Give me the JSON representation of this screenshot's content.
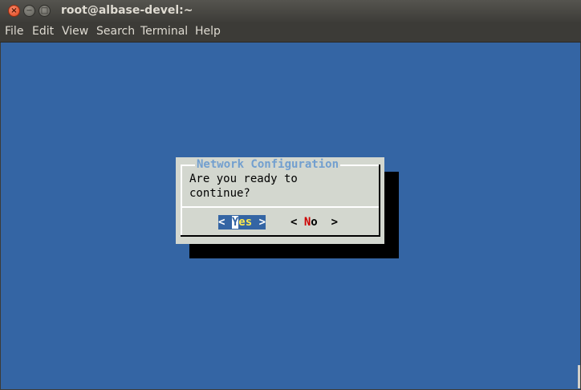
{
  "window": {
    "title": "root@albase-devel:~",
    "close_glyph": "×",
    "minimize_glyph": "−",
    "maximize_glyph": "□"
  },
  "menubar": {
    "items": [
      "File",
      "Edit",
      "View",
      "Search",
      "Terminal",
      "Help"
    ]
  },
  "dialog": {
    "title": "Network Configuration",
    "message_line1": "Are you ready to",
    "message_line2": "continue?",
    "yes_button": {
      "open": "< ",
      "hotkey": "Y",
      "rest": "es",
      "close": " >"
    },
    "no_button": {
      "open": "< ",
      "hotkey": "N",
      "rest": "o",
      "close": "  >"
    }
  },
  "colors": {
    "terminal_bg": "#3465a4",
    "dialog_bg": "#d3d7cf",
    "title_color": "#729fcf",
    "selected_bg": "#3465a4",
    "selected_rest": "#fce94f",
    "no_hotkey": "#cc0000"
  }
}
